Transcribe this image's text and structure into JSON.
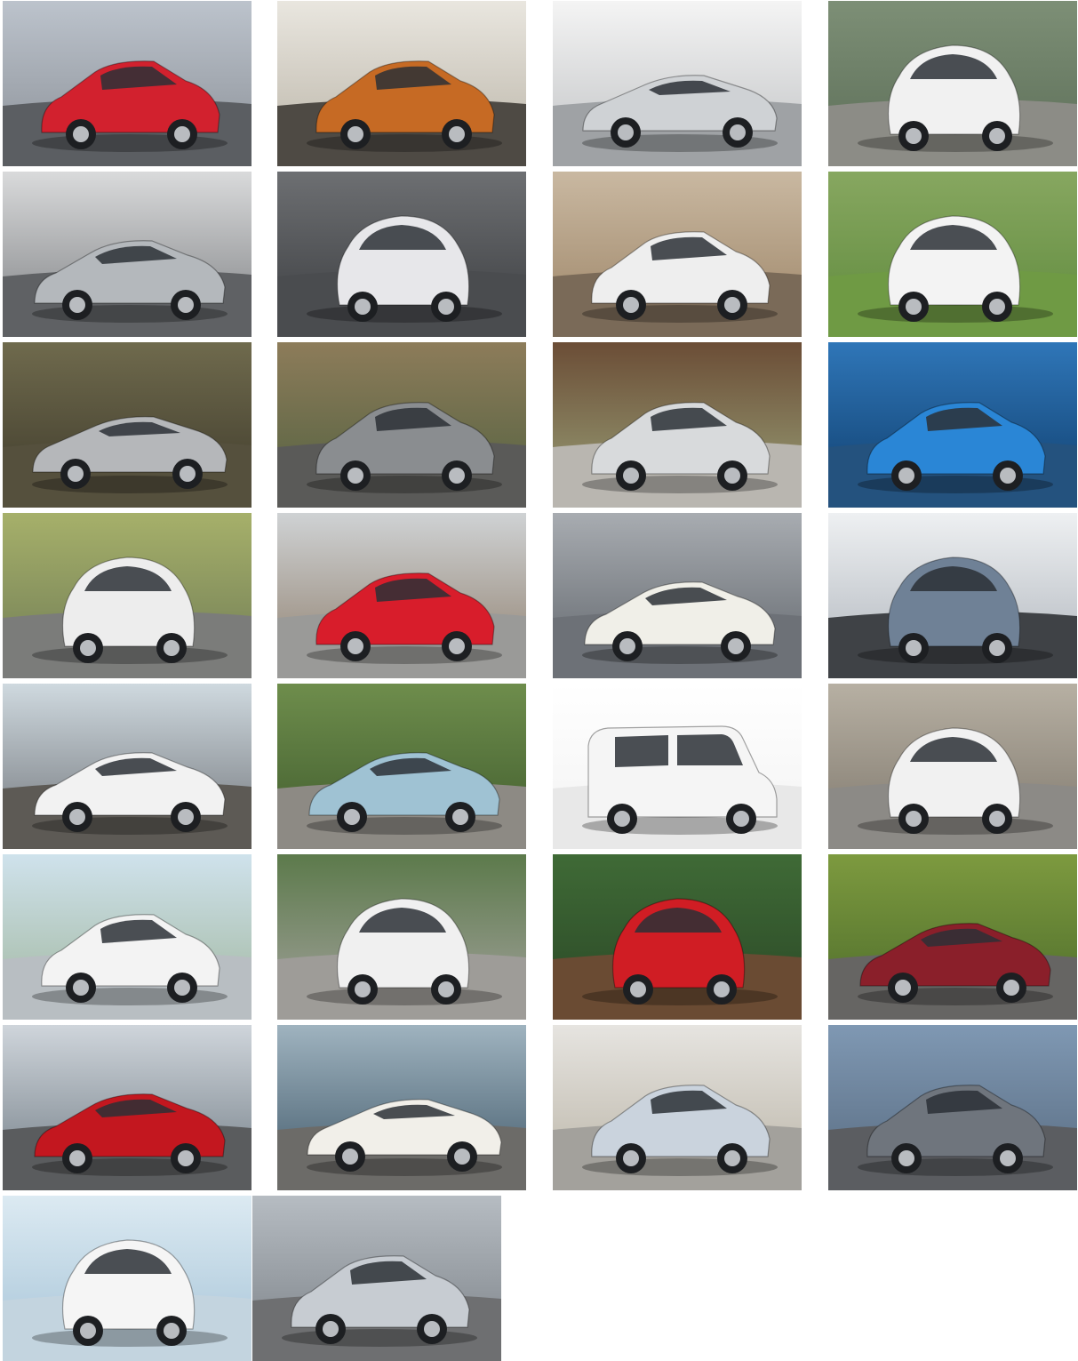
{
  "gallery": {
    "tiles": [
      {
        "car": "red-hatchback-photo",
        "bg": [
          "#bcc3cc",
          "#8a8f96"
        ],
        "ground": "#5b5e62",
        "body": "#d2212e",
        "style": "hatch"
      },
      {
        "car": "orange-compact-photo",
        "bg": [
          "#e9e6df",
          "#b9b3a6"
        ],
        "ground": "#4e4a44",
        "body": "#c66a24",
        "style": "hatch"
      },
      {
        "car": "silver-sports-coupe-photo",
        "bg": [
          "#f4f4f4",
          "#bfc1c3"
        ],
        "ground": "#9fa2a5",
        "body": "#cfd2d5",
        "style": "coupe"
      },
      {
        "car": "white-microcar-photo",
        "bg": [
          "#7d8f76",
          "#5b6d57"
        ],
        "ground": "#8c8c86",
        "body": "#f1f1f1",
        "style": "micro"
      },
      {
        "car": "silver-sedan-photo",
        "bg": [
          "#d9dadb",
          "#7d7f82"
        ],
        "ground": "#5f6164",
        "body": "#b4b8bc",
        "style": "sedan"
      },
      {
        "car": "white-purple-minicar-photo",
        "bg": [
          "#6d6f72",
          "#3b3d40"
        ],
        "ground": "#4a4c4f",
        "body": "#e7e7ea",
        "style": "micro"
      },
      {
        "car": "white-crossover-desert-photo",
        "bg": [
          "#c9b8a1",
          "#9c8466"
        ],
        "ground": "#7a6a58",
        "body": "#eeeeee",
        "style": "hatch"
      },
      {
        "car": "white-three-wheeler-photo",
        "bg": [
          "#87a760",
          "#5f8a3d"
        ],
        "ground": "#6f9a44",
        "body": "#f3f3f3",
        "style": "micro"
      },
      {
        "car": "silver-sports-car-photo",
        "bg": [
          "#6f6a4d",
          "#3e3a2b"
        ],
        "ground": "#55503d",
        "body": "#b5b7ba",
        "style": "coupe"
      },
      {
        "car": "grey-hatchback-motion-photo",
        "bg": [
          "#8d7c5a",
          "#50603f"
        ],
        "ground": "#5a5a58",
        "body": "#8a8d90",
        "style": "hatch"
      },
      {
        "car": "silver-mpv-charging-photo",
        "bg": [
          "#6b4d36",
          "#9aa279"
        ],
        "ground": "#b9b6b0",
        "body": "#d8dadc",
        "style": "hatch"
      },
      {
        "car": "blue-hatchback-bridge-photo",
        "bg": [
          "#2f76b8",
          "#0f3d6b"
        ],
        "ground": "#24527e",
        "body": "#2a86d6",
        "style": "hatch"
      },
      {
        "car": "white-red-minicar-photo",
        "bg": [
          "#a6b06a",
          "#6f7b55"
        ],
        "ground": "#7b7c7a",
        "body": "#ededed",
        "style": "micro"
      },
      {
        "car": "red-hatchback-building-photo",
        "bg": [
          "#cfd2d4",
          "#8e7e6c"
        ],
        "ground": "#9a9a98",
        "body": "#d81d2b",
        "style": "hatch"
      },
      {
        "car": "white-sedan-tunnel-photo",
        "bg": [
          "#a8acb1",
          "#5f646a"
        ],
        "ground": "#6d7177",
        "body": "#f0efe8",
        "style": "sedan"
      },
      {
        "car": "blue-grey-minicar-photo",
        "bg": [
          "#eef0f2",
          "#aeb4bb"
        ],
        "ground": "#3f4246",
        "body": "#6f8196",
        "style": "micro"
      },
      {
        "car": "white-luxury-sedan-photo",
        "bg": [
          "#cfd9df",
          "#6f7378"
        ],
        "ground": "#5d5a55",
        "body": "#f2f2f2",
        "style": "sedan"
      },
      {
        "car": "blue-sedan-garden-photo",
        "bg": [
          "#6e8d4c",
          "#3f5b2d"
        ],
        "ground": "#8d8a84",
        "body": "#9fc2d3",
        "style": "sedan"
      },
      {
        "car": "white-van-photo",
        "bg": [
          "#ffffff",
          "#f2f2f2"
        ],
        "ground": "#e8e8e8",
        "body": "#f5f5f5",
        "style": "van"
      },
      {
        "car": "white-two-seater-street-photo",
        "bg": [
          "#b7b0a3",
          "#7d766b"
        ],
        "ground": "#8c8a86",
        "body": "#f1f1f1",
        "style": "micro"
      },
      {
        "car": "white-hatchback-park-photo",
        "bg": [
          "#cfe2ec",
          "#9fb59c"
        ],
        "ground": "#b8bec2",
        "body": "#f3f3f3",
        "style": "hatch"
      },
      {
        "car": "white-city-car-photo",
        "bg": [
          "#5c7a4b",
          "#a5a39f"
        ],
        "ground": "#9e9c98",
        "body": "#f0f0f0",
        "style": "micro"
      },
      {
        "car": "red-mini-suv-photo",
        "bg": [
          "#3f6a36",
          "#2a4726"
        ],
        "ground": "#6a4b33",
        "body": "#d01d24",
        "style": "micro"
      },
      {
        "car": "red-sedan-motion-photo",
        "bg": [
          "#7d9a3f",
          "#4b6a2a"
        ],
        "ground": "#666563",
        "body": "#8a1f2a",
        "style": "sedan"
      },
      {
        "car": "red-sedan-coast-photo",
        "bg": [
          "#cfd5db",
          "#707b84"
        ],
        "ground": "#5a5c5e",
        "body": "#c3171f",
        "style": "sedan"
      },
      {
        "car": "white-roadster-photo",
        "bg": [
          "#9fb3bf",
          "#3f5768"
        ],
        "ground": "#6c6b68",
        "body": "#f1efe9",
        "style": "coupe"
      },
      {
        "car": "silver-prius-charging-photo",
        "bg": [
          "#e6e4e0",
          "#b9b3a5"
        ],
        "ground": "#a3a19c",
        "body": "#cad3dd",
        "style": "hatch"
      },
      {
        "car": "grey-hatchback-city-photo",
        "bg": [
          "#7f98b3",
          "#576a7f"
        ],
        "ground": "#5b5d61",
        "body": "#6f757d",
        "style": "hatch"
      },
      {
        "car": "white-small-hatch-studio-photo",
        "bg": [
          "#dceaf2",
          "#a5c3d7"
        ],
        "ground": "#c3d4df",
        "body": "#f5f5f5",
        "style": "micro"
      },
      {
        "car": "silver-hatchback-urban-photo",
        "bg": [
          "#b6bcc2",
          "#7a8086"
        ],
        "ground": "#6e6f71",
        "body": "#c7ccd2",
        "style": "hatch"
      }
    ]
  }
}
